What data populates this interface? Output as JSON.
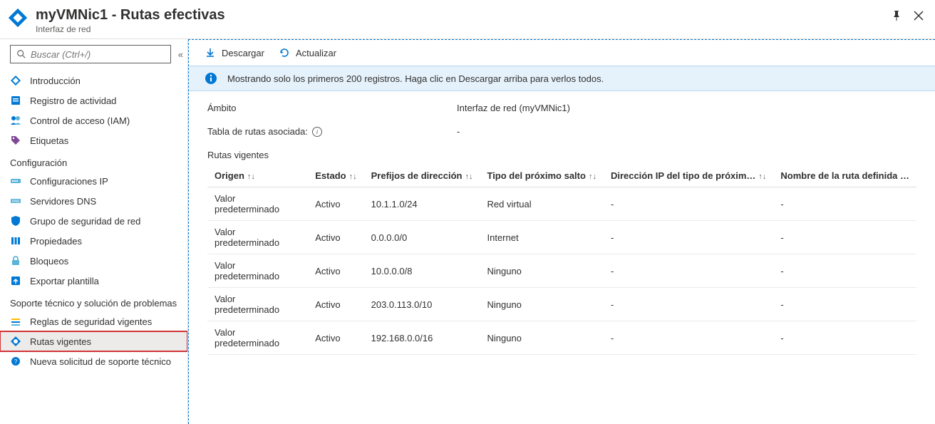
{
  "header": {
    "title": "myVMNic1 - Rutas efectivas",
    "subtitle": "Interfaz de red"
  },
  "sidebar": {
    "search_placeholder": "Buscar (Ctrl+/)",
    "items_top": [
      {
        "label": "Introducción",
        "icon": "overview"
      },
      {
        "label": "Registro de actividad",
        "icon": "activity"
      },
      {
        "label": "Control de acceso (IAM)",
        "icon": "iam"
      },
      {
        "label": "Etiquetas",
        "icon": "tags"
      }
    ],
    "section_config": "Configuración",
    "items_config": [
      {
        "label": "Configuraciones IP",
        "icon": "ipconfig"
      },
      {
        "label": "Servidores DNS",
        "icon": "dns"
      },
      {
        "label": "Grupo de seguridad de red",
        "icon": "nsg"
      },
      {
        "label": "Propiedades",
        "icon": "props"
      },
      {
        "label": "Bloqueos",
        "icon": "locks"
      },
      {
        "label": "Exportar plantilla",
        "icon": "export"
      }
    ],
    "section_support": "Soporte técnico y solución de problemas",
    "items_support": [
      {
        "label": "Reglas de seguridad vigentes",
        "icon": "secrules"
      },
      {
        "label": "Rutas vigentes",
        "icon": "routes",
        "active": true,
        "highlighted": true
      },
      {
        "label": "Nueva solicitud de soporte técnico",
        "icon": "support"
      }
    ]
  },
  "toolbar": {
    "download": "Descargar",
    "refresh": "Actualizar"
  },
  "info_bar": "Mostrando solo los primeros 200 registros. Haga clic en Descargar arriba para verlos todos.",
  "scope": {
    "label": "Ámbito",
    "value": "Interfaz de red (myVMNic1)"
  },
  "route_table_assoc": {
    "label": "Tabla de rutas asociada:",
    "value": "-"
  },
  "routes_section_title": "Rutas vigentes",
  "table": {
    "headers": [
      "Origen",
      "Estado",
      "Prefijos de dirección",
      "Tipo del próximo salto",
      "Dirección IP del tipo de próxim…",
      "Nombre de la ruta definida …"
    ],
    "rows": [
      {
        "origin": "Valor predeterminado",
        "state": "Activo",
        "prefix": "10.1.1.0/24",
        "hop_type": "Red virtual",
        "hop_ip": "-",
        "route_name": "-"
      },
      {
        "origin": "Valor predeterminado",
        "state": "Activo",
        "prefix": "0.0.0.0/0",
        "hop_type": "Internet",
        "hop_ip": "-",
        "route_name": "-"
      },
      {
        "origin": "Valor predeterminado",
        "state": "Activo",
        "prefix": "10.0.0.0/8",
        "hop_type": "Ninguno",
        "hop_ip": "-",
        "route_name": "-"
      },
      {
        "origin": "Valor predeterminado",
        "state": "Activo",
        "prefix": "203.0.113.0/10",
        "hop_type": "Ninguno",
        "hop_ip": "-",
        "route_name": "-"
      },
      {
        "origin": "Valor predeterminado",
        "state": "Activo",
        "prefix": "192.168.0.0/16",
        "hop_type": "Ninguno",
        "hop_ip": "-",
        "route_name": "-"
      }
    ]
  },
  "colors": {
    "accent": "#0078d4",
    "info_bg": "#e6f2fb",
    "highlight": "#d13438"
  }
}
